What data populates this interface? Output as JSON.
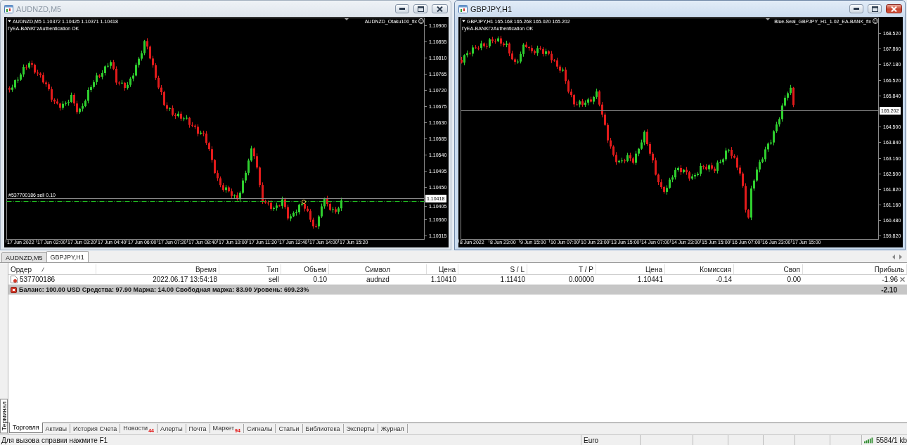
{
  "chart_windows": [
    {
      "title": "AUDNZD,M5",
      "active": false,
      "info": "AUDNZD,M5 1.10372 1.10425 1.10371 1.10418",
      "status": "ГуEA-BANKГzAuthentication OK",
      "expert": "AUDNZD_Otaku100_fix",
      "price_axis": [
        "1.10900",
        "1.10855",
        "1.10810",
        "1.10765",
        "1.10720",
        "1.10675",
        "1.10630",
        "1.10585",
        "1.10540",
        "1.10495",
        "1.10450",
        "1.10405",
        "1.10360",
        "1.10315"
      ],
      "bid": "1.10418",
      "order_line": "#537700186 sell 0.10",
      "time_axis": [
        "17 Jun 2022",
        "17 Jun 02:00",
        "17 Jun 03:20",
        "17 Jun 04:40",
        "17 Jun 06:00",
        "17 Jun 07:20",
        "17 Jun 08:40",
        "17 Jun 10:00",
        "17 Jun 11:20",
        "17 Jun 12:40",
        "17 Jun 14:00",
        "17 Jun 15:20"
      ]
    },
    {
      "title": "GBPJPY,H1",
      "active": true,
      "info": "GBPJPY,H1 165.168 165.268 165.020 165.202",
      "status": "ГуEA-BANKГzAuthentication OK",
      "expert": "Blue-Seal_GBPJPY_H1_1.02_EA-BANK_fix",
      "price_axis": [
        "168.520",
        "167.860",
        "167.180",
        "166.520",
        "165.840",
        "164.500",
        "163.840",
        "163.160",
        "162.500",
        "161.820",
        "161.160",
        "160.480",
        "159.820"
      ],
      "bid": "165.202",
      "time_axis": [
        "8 Jun 2022",
        "8 Jun 23:00",
        "9 Jun 15:00",
        "10 Jun 07:00",
        "10 Jun 23:00",
        "13 Jun 15:00",
        "14 Jun 07:00",
        "14 Jun 23:00",
        "15 Jun 15:00",
        "16 Jun 07:00",
        "16 Jun 23:00",
        "17 Jun 15:00"
      ]
    }
  ],
  "chart_tabs": [
    {
      "label": "AUDNZD,M5",
      "selected": false
    },
    {
      "label": "GBPJPY,H1",
      "selected": true
    }
  ],
  "terminal": {
    "side_label": "Терминал",
    "columns": [
      {
        "label": "Ордер",
        "sorted": true
      },
      {
        "label": "Время",
        "sorted": false
      },
      {
        "label": "Тип",
        "sorted": false
      },
      {
        "label": "Объем",
        "sorted": false
      },
      {
        "label": "Символ",
        "sorted": false
      },
      {
        "label": "Цена",
        "sorted": false
      },
      {
        "label": "S / L",
        "sorted": false
      },
      {
        "label": "T / P",
        "sorted": false
      },
      {
        "label": "Цена",
        "sorted": false
      },
      {
        "label": "Комиссия",
        "sorted": false
      },
      {
        "label": "Своп",
        "sorted": false
      },
      {
        "label": "Прибыль",
        "sorted": false
      }
    ],
    "rows": [
      {
        "cells": [
          "537700186",
          "2022.06.17 13:54:18",
          "sell",
          "0.10",
          "audnzd",
          "1.10410",
          "1.11410",
          "0.00000",
          "1.10441",
          "-0.14",
          "0.00",
          "-1.96"
        ]
      }
    ],
    "summary": {
      "text": "Баланс: 100.00 USD Средства: 97.90 Маржа: 14.00 Свободная маржа: 83.90 Уровень: 699.23%",
      "profit": "-2.10"
    },
    "tabs": [
      {
        "label": "Торговля",
        "selected": true
      },
      {
        "label": "Активы",
        "selected": false
      },
      {
        "label": "История Счета",
        "selected": false
      },
      {
        "label": "Новости",
        "badge": "44",
        "selected": false
      },
      {
        "label": "Алерты",
        "selected": false
      },
      {
        "label": "Почта",
        "selected": false
      },
      {
        "label": "Маркет",
        "badge": "94",
        "selected": false
      },
      {
        "label": "Сигналы",
        "selected": false
      },
      {
        "label": "Статьи",
        "selected": false
      },
      {
        "label": "Библиотека",
        "selected": false
      },
      {
        "label": "Эксперты",
        "selected": false
      },
      {
        "label": "Журнал",
        "selected": false
      }
    ]
  },
  "status_bar": {
    "help": "Для вызова справки нажмите F1",
    "profile": "Euro",
    "traffic": "5584/1 kb"
  }
}
